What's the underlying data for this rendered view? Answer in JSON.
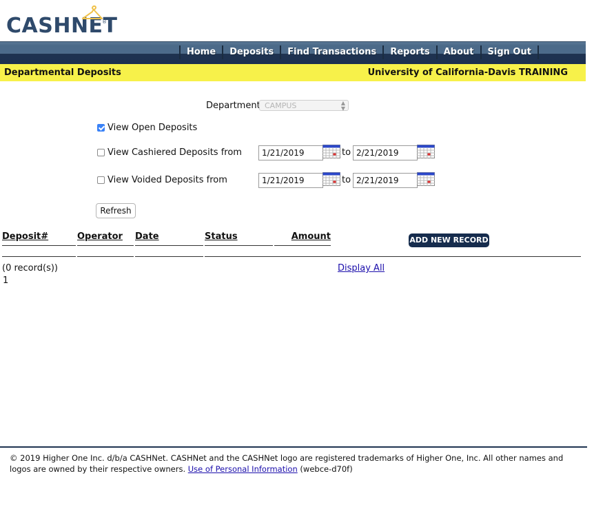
{
  "brand": {
    "logo_text": "CASHNET",
    "logo_reg": "®"
  },
  "nav": {
    "items": [
      "Home",
      "Deposits",
      "Find Transactions",
      "Reports",
      "About",
      "Sign Out"
    ]
  },
  "titlebar": {
    "left": "Departmental Deposits",
    "right": "University of California-Davis TRAINING"
  },
  "form": {
    "department_label": "Department",
    "department_value": "CAMPUS",
    "view_open_label": "View Open Deposits",
    "view_open_checked": true,
    "view_cashiered_label": "View Cashiered Deposits from",
    "view_cashiered_checked": false,
    "cashiered_from": "1/21/2019",
    "cashiered_to": "2/21/2019",
    "view_voided_label": "View Voided Deposits from",
    "view_voided_checked": false,
    "voided_from": "1/21/2019",
    "voided_to": "2/21/2019",
    "to_label": "to",
    "refresh_label": "Refresh"
  },
  "table": {
    "headers": [
      "Deposit#",
      "Operator",
      "Date",
      "Status",
      "Amount"
    ],
    "add_new_label": "ADD NEW RECORD",
    "record_count": "(0 record(s))",
    "page": "1",
    "display_all": "Display All"
  },
  "footer": {
    "copyright": "© 2019 Higher One Inc. d/b/a CASHNet.  CASHNet and the CASHNet logo are registered trademarks of Higher One, Inc.  All other names and logos are owned by their respective owners.",
    "privacy_link": "Use of Personal Information",
    "build": "(webce-d70f)"
  },
  "colors": {
    "nav_top": "#4d6b8a",
    "nav_bottom": "#1c3050",
    "titlebar": "#f7f14a",
    "logo": "#2f4a6b",
    "accent": "#3a82f7",
    "button_dark": "#162c4d",
    "link": "#1a0dab"
  },
  "icons": [
    "calendar-icon",
    "chevron-down-icon",
    "hanger-icon"
  ]
}
